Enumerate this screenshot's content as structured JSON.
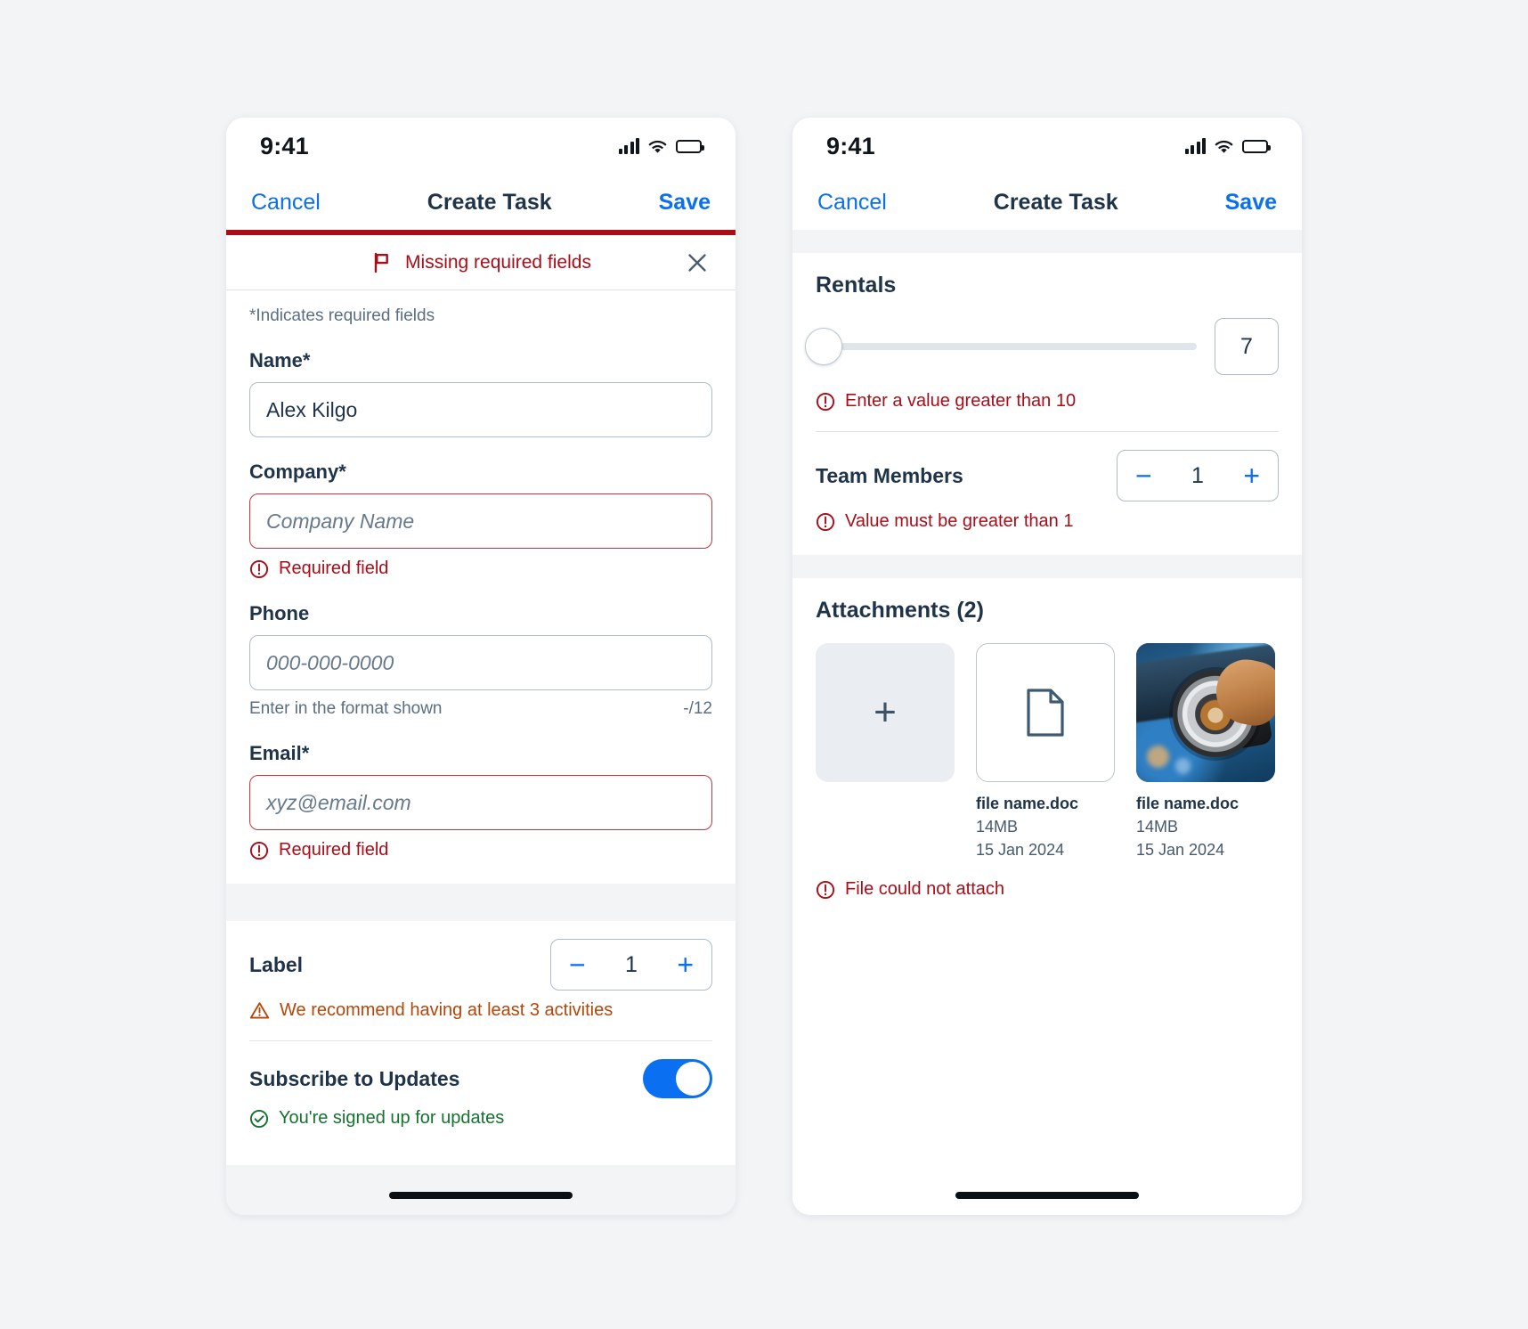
{
  "status_bar": {
    "time": "9:41"
  },
  "nav": {
    "cancel_label": "Cancel",
    "title": "Create Task",
    "save_label": "Save"
  },
  "banner": {
    "text": "Missing required fields",
    "icon": "flag-icon",
    "close_icon": "close-icon",
    "accent_color": "#a90d18"
  },
  "form": {
    "required_hint": "*Indicates required fields",
    "fields": [
      {
        "label": "Name*",
        "value": "Alex Kilgo",
        "placeholder": "",
        "state": "default",
        "message": "",
        "helper": "",
        "counter": ""
      },
      {
        "label": "Company*",
        "value": "",
        "placeholder": "Company Name",
        "state": "error",
        "message": "Required field",
        "helper": "",
        "counter": ""
      },
      {
        "label": "Phone",
        "value": "",
        "placeholder": "000-000-0000",
        "state": "default",
        "message": "",
        "helper": "Enter in the format shown",
        "counter": "-/12"
      },
      {
        "label": "Email*",
        "value": "",
        "placeholder": "xyz@email.com",
        "state": "error",
        "message": "Required field",
        "helper": "",
        "counter": ""
      }
    ],
    "label_stepper": {
      "label": "Label",
      "minus": "−",
      "value": "1",
      "plus": "+",
      "message": "We recommend having at least 3 activities",
      "message_state": "warning"
    },
    "subscribe": {
      "label": "Subscribe to Updates",
      "toggle_on": true,
      "message": "You're signed up for updates",
      "message_state": "success"
    }
  },
  "right_screen": {
    "rentals": {
      "title": "Rentals",
      "slider_value": "7",
      "slider_percent": 2,
      "message": "Enter a value greater than 10",
      "message_state": "error"
    },
    "team_members": {
      "label": "Team Members",
      "minus": "−",
      "value": "1",
      "plus": "+",
      "message": "Value must be greater than 1",
      "message_state": "error"
    },
    "attachments": {
      "title": "Attachments (2)",
      "add_icon": "plus-icon",
      "items": [
        {
          "kind": "document",
          "icon": "document-icon",
          "name": "file name.doc",
          "size": "14MB",
          "date": "15 Jan 2024"
        },
        {
          "kind": "image",
          "icon": "image-thumbnail",
          "name": "file name.doc",
          "size": "14MB",
          "date": "15 Jan 2024"
        }
      ],
      "message": "File could not attach",
      "message_state": "error"
    }
  },
  "colors": {
    "brand_blue": "#0a6ff0",
    "error_red": "#a90d18",
    "warning_orange": "#b44708",
    "success_green": "#15722f",
    "text_dark": "#1f3349"
  }
}
